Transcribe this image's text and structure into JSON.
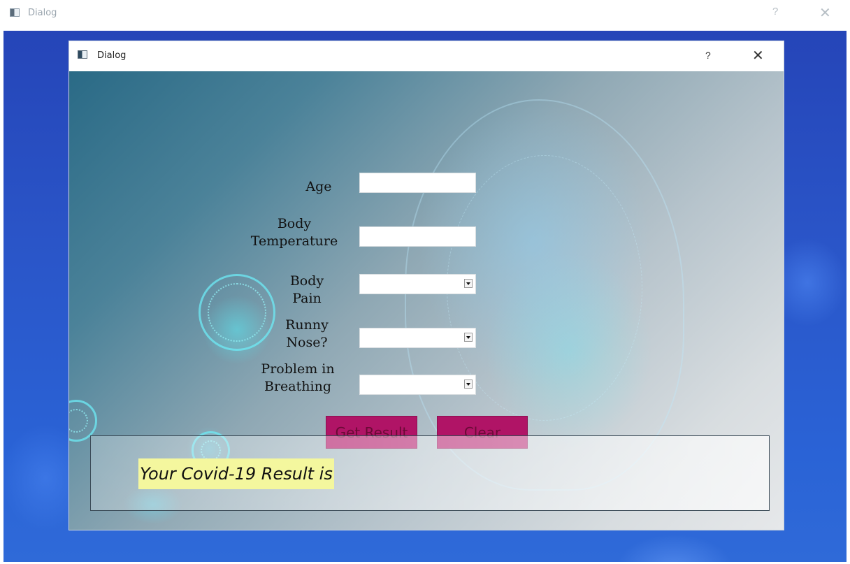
{
  "outer_window": {
    "title": "Dialog",
    "help_glyph": "?",
    "close_glyph": "✕"
  },
  "dialog": {
    "title": "Dialog",
    "help_glyph": "?",
    "close_glyph": "✕",
    "form": {
      "age": {
        "label": "Age",
        "value": ""
      },
      "body_temperature": {
        "label_line1": "Body",
        "label_line2": "Temperature",
        "value": ""
      },
      "body_pain": {
        "label_line1": "Body",
        "label_line2": "Pain",
        "selected": ""
      },
      "runny_nose": {
        "label_line1": "Runny",
        "label_line2": "Nose?",
        "selected": ""
      },
      "problem_breathing": {
        "label_line1": "Problem in",
        "label_line2": "Breathing",
        "selected": ""
      }
    },
    "buttons": {
      "get_result": "Get Result",
      "clear": "Clear"
    },
    "result": {
      "text": "Your Covid-19 Result is"
    }
  },
  "colors": {
    "button_bg": "#b01466",
    "result_highlight": "#f4f79e",
    "outer_bg": "#2a55c8"
  },
  "icons": [
    "window-icon",
    "help-icon",
    "close-icon",
    "dropdown-arrow-icon"
  ]
}
